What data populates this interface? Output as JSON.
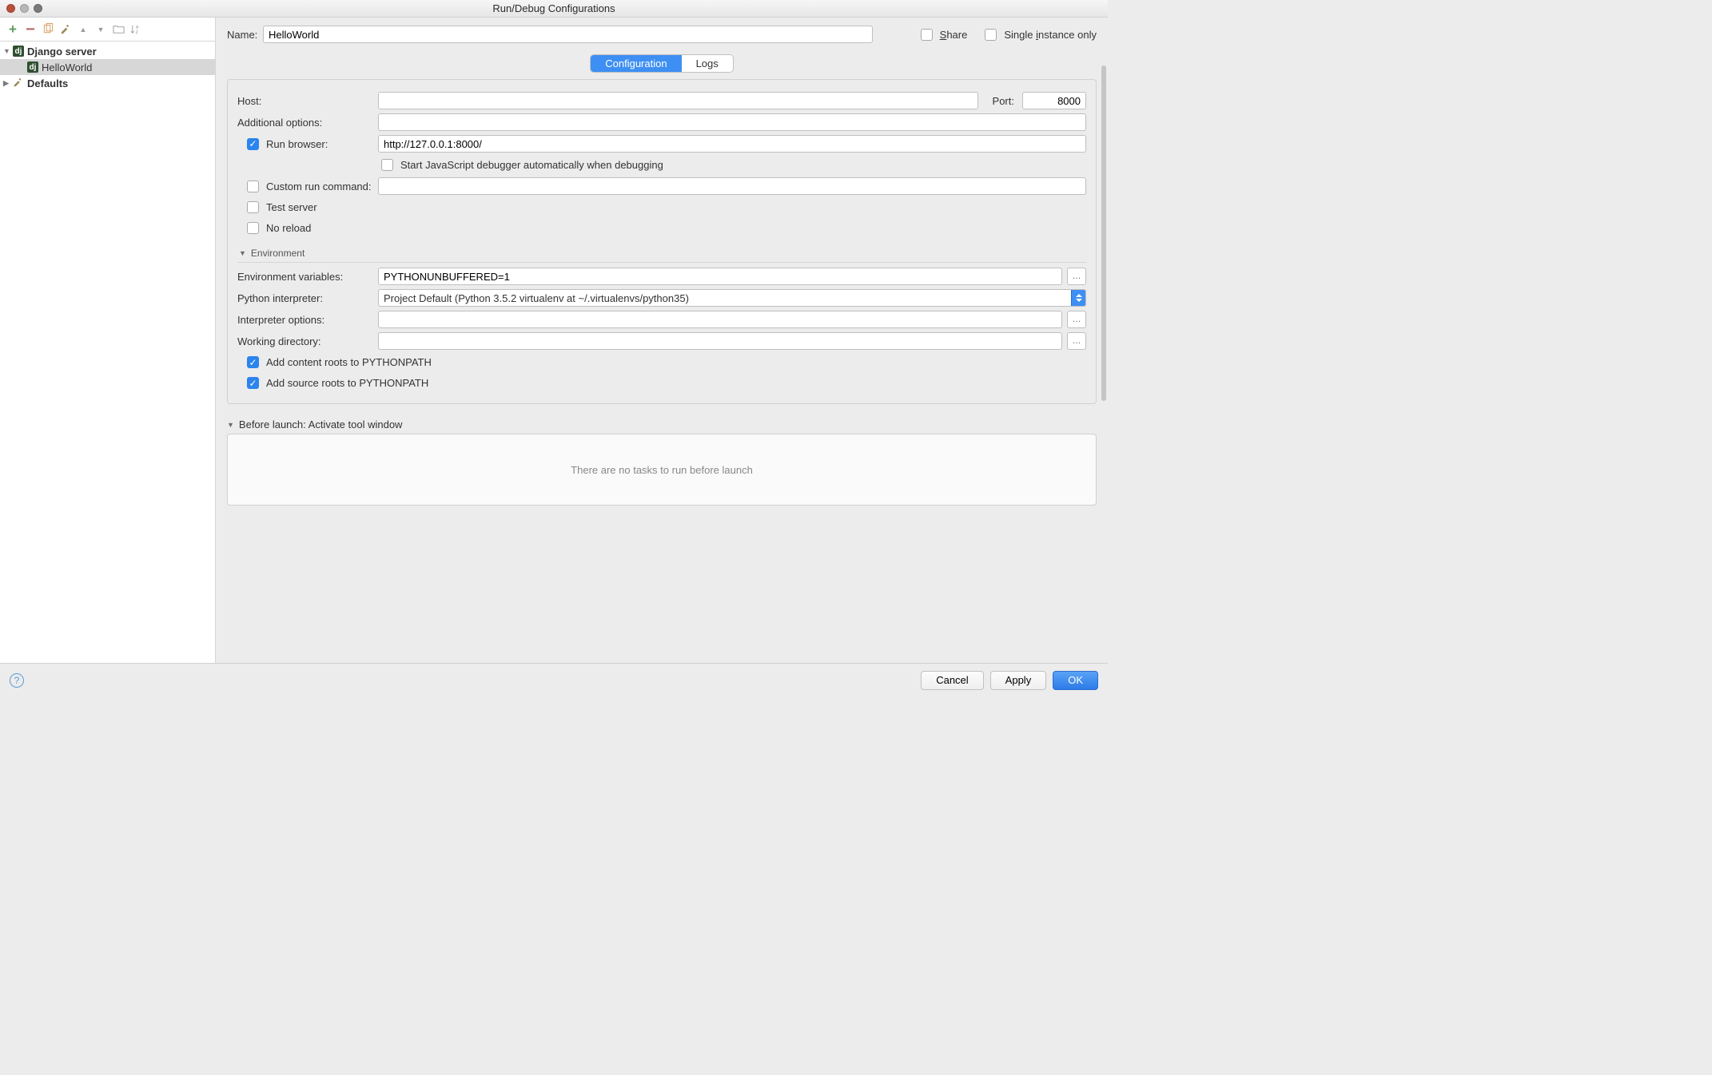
{
  "window": {
    "title": "Run/Debug Configurations"
  },
  "sidebar": {
    "groups": [
      {
        "label": "Django server",
        "items": [
          {
            "label": "HelloWorld"
          }
        ]
      },
      {
        "label": "Defaults",
        "items": []
      }
    ]
  },
  "form": {
    "name_label": "Name:",
    "name_value": "HelloWorld",
    "share_label": "Share",
    "single_label": "Single instance only",
    "share_checked": false,
    "single_checked": false
  },
  "tabs": {
    "active": "Configuration",
    "items": [
      "Configuration",
      "Logs"
    ]
  },
  "config": {
    "host_label": "Host:",
    "host_value": "",
    "port_label": "Port:",
    "port_value": "8000",
    "addl_label": "Additional options:",
    "addl_value": "",
    "run_browser_checked": true,
    "run_browser_label": "Run browser:",
    "run_browser_value": "http://127.0.0.1:8000/",
    "start_js_dbg_label": "Start JavaScript debugger automatically when debugging",
    "start_js_dbg_checked": false,
    "custom_run_cmd_label": "Custom run command:",
    "custom_run_cmd_checked": false,
    "custom_run_cmd_value": "",
    "test_server_label": "Test server",
    "test_server_checked": false,
    "no_reload_label": "No reload",
    "no_reload_checked": false,
    "env_section_label": "Environment",
    "env_vars_label": "Environment variables:",
    "env_vars_value": "PYTHONUNBUFFERED=1",
    "py_interp_label": "Python interpreter:",
    "py_interp_value": "Project Default (Python 3.5.2 virtualenv at ~/.virtualenvs/python35)",
    "interp_opts_label": "Interpreter options:",
    "interp_opts_value": "",
    "work_dir_label": "Working directory:",
    "work_dir_value": "",
    "add_content_roots_label": "Add content roots to PYTHONPATH",
    "add_content_roots_checked": true,
    "add_source_roots_label": "Add source roots to PYTHONPATH",
    "add_source_roots_checked": true
  },
  "before": {
    "header": "Before launch: Activate tool window",
    "empty_text": "There are no tasks to run before launch"
  },
  "footer": {
    "cancel": "Cancel",
    "apply": "Apply",
    "ok": "OK"
  }
}
